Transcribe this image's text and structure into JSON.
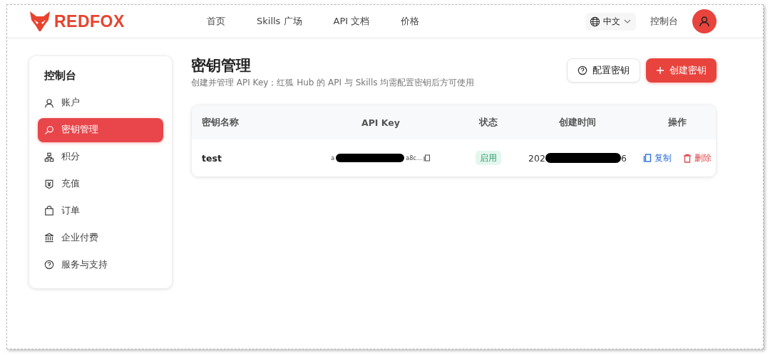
{
  "header": {
    "logo": "REDFOX",
    "nav": [
      {
        "label": "首页",
        "selected": false
      },
      {
        "label": "Skills 广场",
        "selected": false
      },
      {
        "label": "API 文档",
        "selected": false
      },
      {
        "label": "价格",
        "selected": false
      }
    ],
    "language": "中文",
    "console_link": "控制台"
  },
  "sidebar": {
    "title": "控制台",
    "items": [
      {
        "label": "账户",
        "kind": "user",
        "selected": false
      },
      {
        "label": "密钥管理",
        "kind": "search",
        "selected": true
      },
      {
        "label": "积分",
        "kind": "tree",
        "selected": false
      },
      {
        "label": "充值",
        "kind": "yen",
        "selected": false
      },
      {
        "label": "订单",
        "kind": "bag",
        "selected": false
      },
      {
        "label": "企业付费",
        "kind": "bank",
        "selected": false
      },
      {
        "label": "服务与支持",
        "kind": "help",
        "selected": false
      }
    ]
  },
  "page": {
    "title": "密钥管理",
    "subtitle": "创建并管理 API Key；红狐 Hub 的 API 与 Skills 均需配置密钥后方可使用",
    "buttons": [
      {
        "label": "配置密钥",
        "kind": "secondary"
      },
      {
        "label": "创建密钥",
        "kind": "primary"
      }
    ]
  },
  "table": {
    "columns": [
      "密钥名称",
      "API Key",
      "状态",
      "创建时间",
      "操作"
    ],
    "rows": [
      {
        "name": "test",
        "key_start": "a",
        "key_end": "a8c…",
        "status": "启用",
        "enabled": true,
        "time_start": "202",
        "time_end": "6",
        "actions": [
          {
            "label": "复制",
            "kind": "copy"
          },
          {
            "label": "删除",
            "kind": "delete"
          }
        ]
      }
    ]
  }
}
